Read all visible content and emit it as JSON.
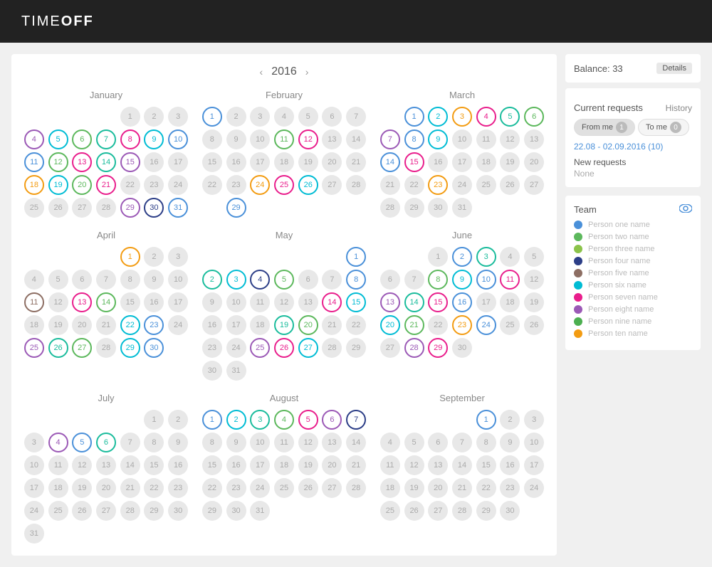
{
  "header": {
    "logo_text": "TIME",
    "logo_bold": "OFF"
  },
  "year_nav": {
    "prev": "‹",
    "year": "2016",
    "next": "›"
  },
  "sidebar": {
    "balance_label": "Balance: 33",
    "details_btn": "Details",
    "current_requests_label": "Current requests",
    "history_label": "History",
    "from_me_label": "From me",
    "from_me_count": "1",
    "to_me_label": "To me",
    "to_me_count": "0",
    "date_range": "22.08 - 02.09.2016 (10)",
    "new_requests_label": "New requests",
    "none_label": "None",
    "team_label": "Team",
    "team_members": [
      {
        "name": "Person one name",
        "color": "#4a90d9"
      },
      {
        "name": "Person two name",
        "color": "#5cb85c"
      },
      {
        "name": "Person three name",
        "color": "#8bc34a"
      },
      {
        "name": "Person four name",
        "color": "#2c3e87"
      },
      {
        "name": "Person five name",
        "color": "#8d6e63"
      },
      {
        "name": "Person six name",
        "color": "#00bcd4"
      },
      {
        "name": "Person seven name",
        "color": "#e91e8c"
      },
      {
        "name": "Person eight name",
        "color": "#9b59b6"
      },
      {
        "name": "Person nine name",
        "color": "#4caf50"
      },
      {
        "name": "Person ten name",
        "color": "#f39c12"
      }
    ]
  },
  "months": [
    {
      "name": "January",
      "weeks": 5
    },
    {
      "name": "February",
      "weeks": 4
    },
    {
      "name": "March",
      "weeks": 5
    },
    {
      "name": "April",
      "weeks": 5
    },
    {
      "name": "May",
      "weeks": 5
    },
    {
      "name": "June",
      "weeks": 5
    },
    {
      "name": "July",
      "weeks": 5
    },
    {
      "name": "August",
      "weeks": 5
    },
    {
      "name": "September",
      "weeks": 5
    }
  ]
}
